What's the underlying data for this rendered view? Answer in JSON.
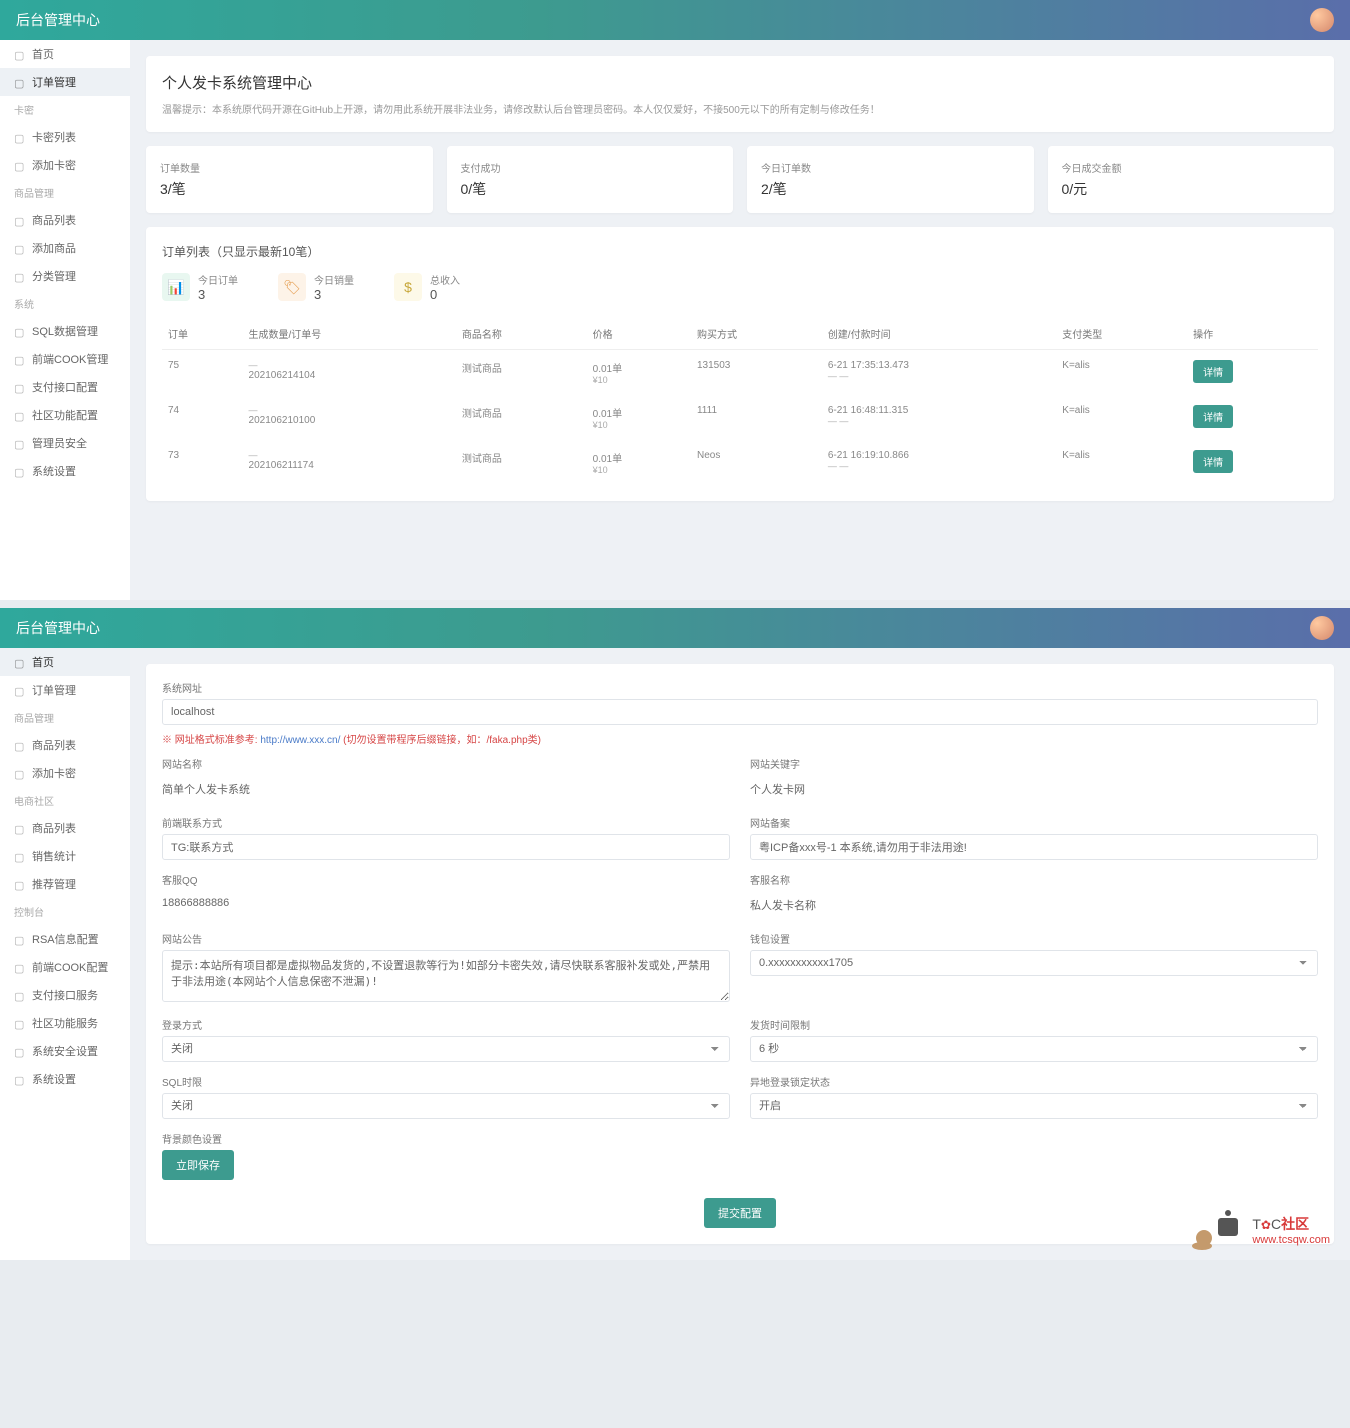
{
  "header": {
    "title": "后台管理中心"
  },
  "sidebar1": {
    "items": [
      {
        "label": "首页",
        "active": false
      },
      {
        "label": "订单管理",
        "active": true
      }
    ],
    "section1": "卡密",
    "items2": [
      {
        "label": "卡密列表"
      },
      {
        "label": "添加卡密"
      }
    ],
    "section2": "商品管理",
    "items3": [
      {
        "label": "商品列表"
      },
      {
        "label": "添加商品"
      },
      {
        "label": "分类管理"
      }
    ],
    "section3": "系统",
    "items4": [
      {
        "label": "SQL数据管理"
      },
      {
        "label": "前端COOK管理"
      },
      {
        "label": "支付接口配置"
      },
      {
        "label": "社区功能配置"
      },
      {
        "label": "管理员安全"
      },
      {
        "label": "系统设置"
      }
    ]
  },
  "welcome": {
    "title": "个人发卡系统管理中心",
    "sub": "温馨提示：本系统原代码开源在GitHub上开源，请勿用此系统开展非法业务，请修改默认后台管理员密码。本人仅仅爱好，不接500元以下的所有定制与修改任务！"
  },
  "stats": [
    {
      "label": "订单数量",
      "value": "3/笔"
    },
    {
      "label": "支付成功",
      "value": "0/笔"
    },
    {
      "label": "今日订单数",
      "value": "2/笔"
    },
    {
      "label": "今日成交金额",
      "value": "0/元"
    }
  ],
  "orders": {
    "title": "订单列表（只显示最新10笔）",
    "mini": [
      {
        "label": "今日订单",
        "value": "3"
      },
      {
        "label": "今日销量",
        "value": "3"
      },
      {
        "label": "总收入",
        "value": "0"
      }
    ],
    "headers": [
      "订单",
      "生成数量/订单号",
      "商品名称",
      "价格",
      "购买方式",
      "创建/付款时间",
      "支付类型",
      "操作"
    ],
    "rows": [
      {
        "id": "75",
        "orderno": "202106214104",
        "product": "测试商品",
        "price": "0.01单",
        "priceub": "¥10",
        "contact": "131503",
        "time1": "6-21 17:35:13.473",
        "time2": "— —",
        "paytype": "K=alis",
        "action": "详情"
      },
      {
        "id": "74",
        "orderno": "202106210100",
        "product": "测试商品",
        "price": "0.01单",
        "priceub": "¥10",
        "contact": "1111",
        "time1": "6-21 16:48:11.315",
        "time2": "— —",
        "paytype": "K=alis",
        "action": "详情"
      },
      {
        "id": "73",
        "orderno": "202106211174",
        "product": "测试商品",
        "price": "0.01单",
        "priceub": "¥10",
        "contact": "Neos",
        "time1": "6-21 16:19:10.866",
        "time2": "— —",
        "paytype": "K=alis",
        "action": "详情"
      }
    ]
  },
  "sidebar2": {
    "items": [
      {
        "label": "首页",
        "active": true
      },
      {
        "label": "订单管理"
      }
    ],
    "section1": "商品管理",
    "items2": [
      {
        "label": "商品列表"
      },
      {
        "label": "添加卡密"
      }
    ],
    "section2": "电商社区",
    "items3": [
      {
        "label": "商品列表"
      },
      {
        "label": "销售统计"
      },
      {
        "label": "推荐管理"
      }
    ],
    "section3": "控制台",
    "items4": [
      {
        "label": "RSA信息配置"
      },
      {
        "label": "前端COOK配置"
      },
      {
        "label": "支付接口服务"
      },
      {
        "label": "社区功能服务"
      },
      {
        "label": "系统安全设置"
      },
      {
        "label": "系统设置"
      }
    ]
  },
  "settings": {
    "sectionLabel": "系统网址",
    "siteUrl": "localhost",
    "hint_prefix": "※ 网址格式标准参考: ",
    "hint_url": "http://www.xxx.cn/ ",
    "hint_mid": "(切勿设置带程序后缀链接，",
    "hint_suffix": "如：/faka.php类)",
    "fields": {
      "siteName_label": "网站名称",
      "siteName_value": "简单个人发卡系统",
      "keywords_label": "网站关键字",
      "keywords_value": "个人发卡网",
      "contact_label": "前端联系方式",
      "contact_value": "TG:联系方式",
      "beian_label": "网站备案",
      "beian_value": "粤ICP备xxx号-1 本系统,请勿用于非法用途!",
      "qq_label": "客服QQ",
      "qq_value": "18866888886",
      "kefu_label": "客服名称",
      "kefu_value": "私人发卡名称",
      "announce_label": "网站公告",
      "announce_value": "提示:本站所有项目都是虚拟物品发货的,不设置退款等行为!如部分卡密失效,请尽快联系客服补发或处,严禁用于非法用途(本网站个人信息保密不泄漏)!",
      "wallet_label": "钱包设置",
      "wallet_value": "0.xxxxxxxxxxx1705",
      "login_label": "登录方式",
      "login_value": "关闭",
      "verify_label": "发货时间限制",
      "verify_value": "6 秒",
      "sms_label": "SQL时限",
      "sms_value": "关闭",
      "lock_label": "异地登录锁定状态",
      "lock_value": "开启",
      "bgcolor_label": "背景颜色设置"
    },
    "btn_save": "立即保存",
    "btn_submit": "提交配置"
  },
  "watermark": {
    "text": "社区",
    "url": "www.tcsqw.com"
  }
}
